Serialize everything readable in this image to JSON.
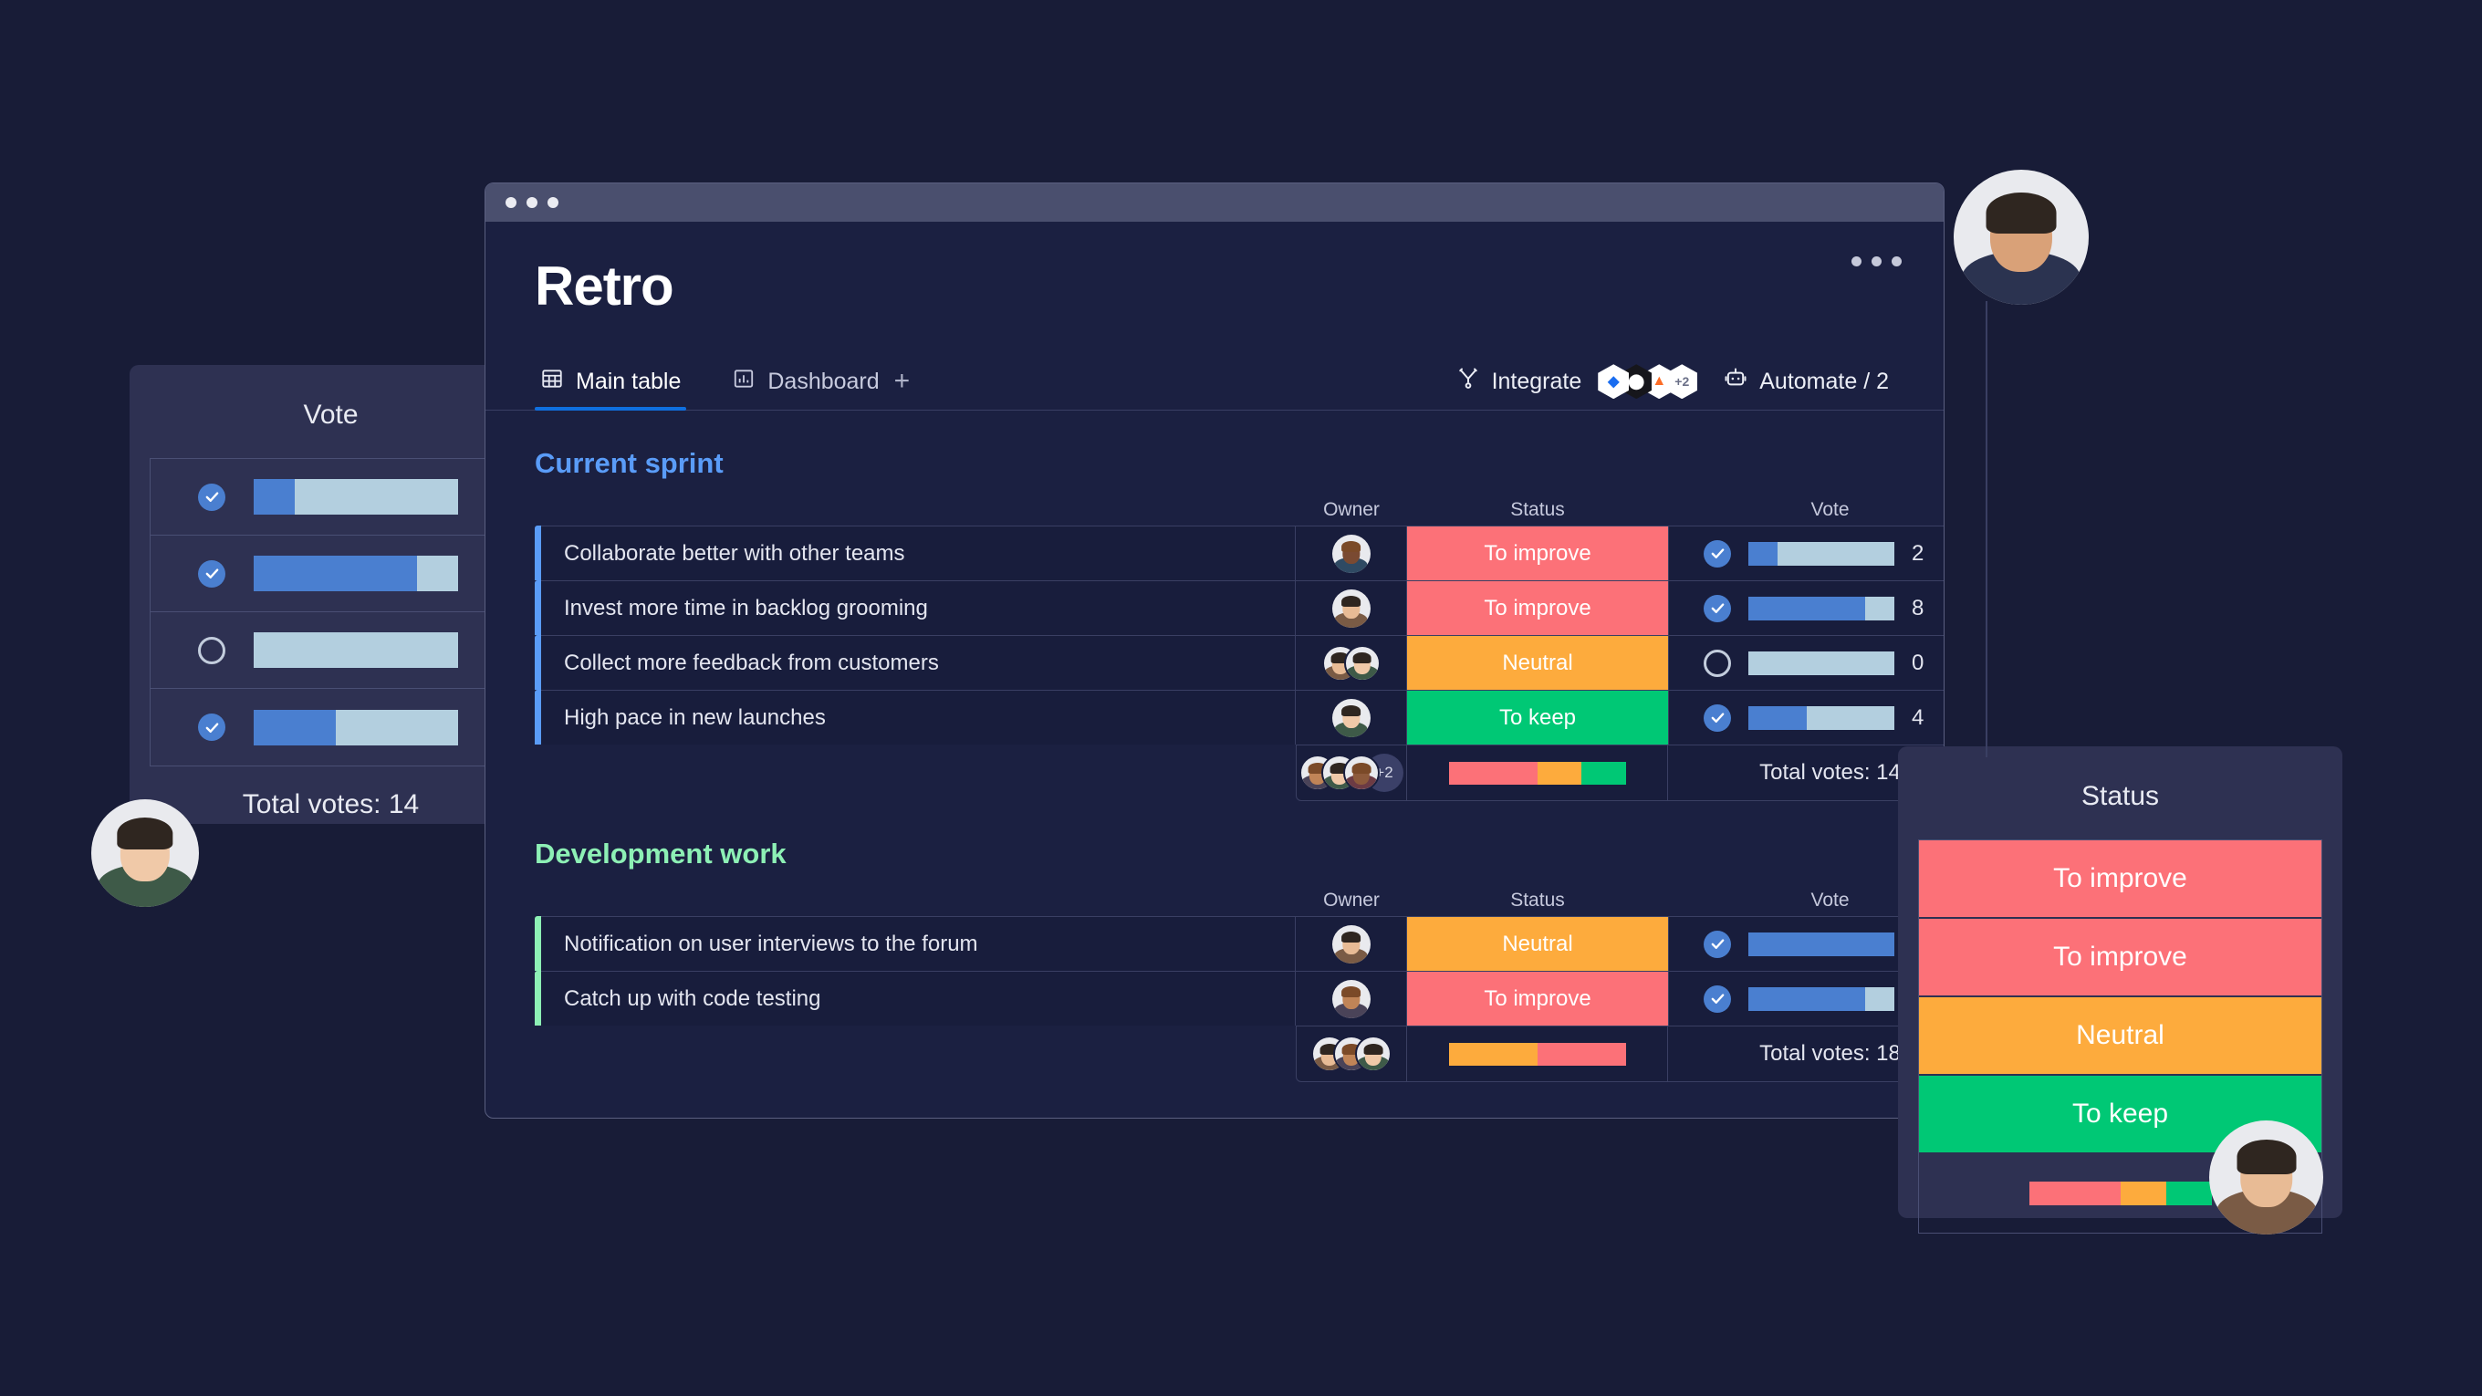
{
  "window": {
    "titlebar_dots": 3,
    "title": "Retro",
    "more_menu_label": "more-options"
  },
  "tabs": {
    "items": [
      {
        "label": "Main table",
        "icon": "table-icon",
        "active": true
      },
      {
        "label": "Dashboard",
        "icon": "bar-chart-icon",
        "active": false
      }
    ],
    "add_label": "+"
  },
  "toolbar": {
    "integrate_label": "Integrate",
    "integrate_icon": "integrate-icon",
    "integrations": [
      {
        "name": "jira-icon",
        "glyph": "◆",
        "bg": "#ffffff",
        "fg": "#1a6df0"
      },
      {
        "name": "github-icon",
        "glyph": "⬤",
        "bg": "#16161b",
        "fg": "#ffffff"
      },
      {
        "name": "gitlab-icon",
        "glyph": "▲",
        "bg": "#ffffff",
        "fg": "#fc6d26"
      },
      {
        "name": "more-integrations",
        "glyph": "+2",
        "bg": "#ffffff",
        "fg": "#6b7088"
      }
    ],
    "automate_label": "Automate / 2",
    "automate_icon": "robot-icon"
  },
  "colors": {
    "to_improve": "#fc7178",
    "neutral": "#fdab3d",
    "to_keep": "#00c875",
    "vote_fill": "#4a7fd0",
    "vote_track": "#b3cfdf",
    "accent_blue": "#5a9cf8",
    "accent_green": "#8df0b5",
    "tab_underline": "#0f6fdf"
  },
  "groups": [
    {
      "title": "Current sprint",
      "accent": "#5a9cf8",
      "columns": {
        "name": "",
        "owner": "Owner",
        "status": "Status",
        "vote": "Vote",
        "add": "+"
      },
      "rows": [
        {
          "name": "Collaborate better with other teams",
          "owner_count": 1,
          "status": "To improve",
          "status_color": "#fc7178",
          "voted": true,
          "vote": 2,
          "vote_pct": 20
        },
        {
          "name": "Invest more time in backlog grooming",
          "owner_count": 1,
          "status": "To improve",
          "status_color": "#fc7178",
          "voted": true,
          "vote": 8,
          "vote_pct": 80
        },
        {
          "name": "Collect more feedback from customers",
          "owner_count": 2,
          "status": "Neutral",
          "status_color": "#fdab3d",
          "voted": false,
          "vote": 0,
          "vote_pct": 0
        },
        {
          "name": "High pace in new  launches",
          "owner_count": 1,
          "status": "To keep",
          "status_color": "#00c875",
          "voted": true,
          "vote": 4,
          "vote_pct": 40
        }
      ],
      "summary": {
        "avatars": 3,
        "avatar_more": "+2",
        "status_breakdown": [
          {
            "label": "To improve",
            "color": "#fc7178",
            "pct": 50
          },
          {
            "label": "Neutral",
            "color": "#fdab3d",
            "pct": 25
          },
          {
            "label": "To keep",
            "color": "#00c875",
            "pct": 25
          }
        ],
        "total_votes_label": "Total votes: 14"
      }
    },
    {
      "title": "Development work",
      "accent": "#8df0b5",
      "columns": {
        "name": "",
        "owner": "Owner",
        "status": "Status",
        "vote": "Vote",
        "add": ""
      },
      "rows": [
        {
          "name": "Notification on user interviews to the forum",
          "owner_count": 1,
          "status": "Neutral",
          "status_color": "#fdab3d",
          "voted": true,
          "vote": 10,
          "vote_pct": 100
        },
        {
          "name": "Catch up with code testing",
          "owner_count": 1,
          "status": "To improve",
          "status_color": "#fc7178",
          "voted": true,
          "vote": 8,
          "vote_pct": 80
        }
      ],
      "summary": {
        "avatars": 3,
        "avatar_more": "",
        "status_breakdown": [
          {
            "label": "Neutral",
            "color": "#fdab3d",
            "pct": 50
          },
          {
            "label": "To improve",
            "color": "#fc7178",
            "pct": 50
          }
        ],
        "total_votes_label": "Total votes: 18"
      }
    }
  ],
  "vote_card": {
    "title": "Vote",
    "rows": [
      {
        "voted": true,
        "vote_pct": 20
      },
      {
        "voted": true,
        "vote_pct": 80
      },
      {
        "voted": false,
        "vote_pct": 0
      },
      {
        "voted": true,
        "vote_pct": 40
      }
    ],
    "total_votes_label": "Total votes: 14"
  },
  "status_card": {
    "title": "Status",
    "rows": [
      {
        "label": "To improve",
        "color": "#fc7178"
      },
      {
        "label": "To improve",
        "color": "#fc7178"
      },
      {
        "label": "Neutral",
        "color": "#fdab3d"
      },
      {
        "label": "To keep",
        "color": "#00c875"
      }
    ],
    "status_breakdown": [
      {
        "color": "#fc7178",
        "pct": 50
      },
      {
        "color": "#fdab3d",
        "pct": 25
      },
      {
        "color": "#00c875",
        "pct": 25
      }
    ]
  },
  "floating_avatars": [
    {
      "name": "avatar-top-right"
    },
    {
      "name": "avatar-bottom-left"
    },
    {
      "name": "avatar-bottom-right"
    }
  ]
}
